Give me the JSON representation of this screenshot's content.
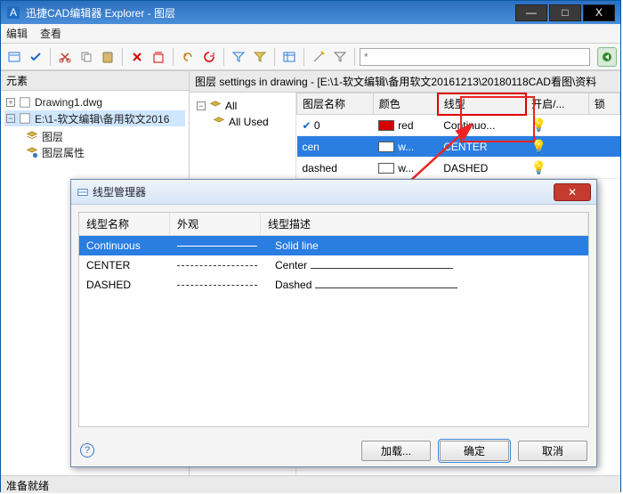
{
  "window": {
    "title": "迅捷CAD编辑器 Explorer - 图层",
    "min": "—",
    "max": "□",
    "close": "X"
  },
  "menu": {
    "edit": "编辑",
    "view": "查看"
  },
  "toolbar": {
    "search_placeholder": "*"
  },
  "left": {
    "header": "元素",
    "drawing1": "Drawing1.dwg",
    "path": "E:\\1-软文编辑\\备用软文2016",
    "layers": "图层",
    "layer_props": "图层属性"
  },
  "crumb": "图层 settings in drawing - [E:\\1-软文编辑\\备用软文20161213\\20180118CAD看图\\资料",
  "minitree": {
    "all": "All",
    "all_used": "All Used"
  },
  "table": {
    "cols": {
      "name": "图层名称",
      "color": "颜色",
      "linetype": "线型",
      "on": "开启/...",
      "lock": "锁"
    },
    "rows": [
      {
        "name": "0",
        "color_label": "red",
        "color": "#d40000",
        "linetype": "Continuo...",
        "on": true,
        "current": true,
        "sel": false
      },
      {
        "name": "cen",
        "color_label": "w...",
        "color": "#ffffff",
        "linetype": "CENTER",
        "on": true,
        "current": false,
        "sel": true
      },
      {
        "name": "dashed",
        "color_label": "w...",
        "color": "#ffffff",
        "linetype": "DASHED",
        "on": true,
        "current": false,
        "sel": false
      }
    ]
  },
  "dialog": {
    "title": "线型管理器",
    "cols": {
      "name": "线型名称",
      "appearance": "外观",
      "desc": "线型描述"
    },
    "rows": [
      {
        "name": "Continuous",
        "desc": "Solid line",
        "style": "solid",
        "sel": true
      },
      {
        "name": "CENTER",
        "desc": "Center",
        "style": "centerdash",
        "sel": false
      },
      {
        "name": "DASHED",
        "desc": "Dashed",
        "style": "dash",
        "sel": false
      }
    ],
    "buttons": {
      "load": "加载...",
      "ok": "确定",
      "cancel": "取消"
    }
  },
  "status": "准备就绪"
}
